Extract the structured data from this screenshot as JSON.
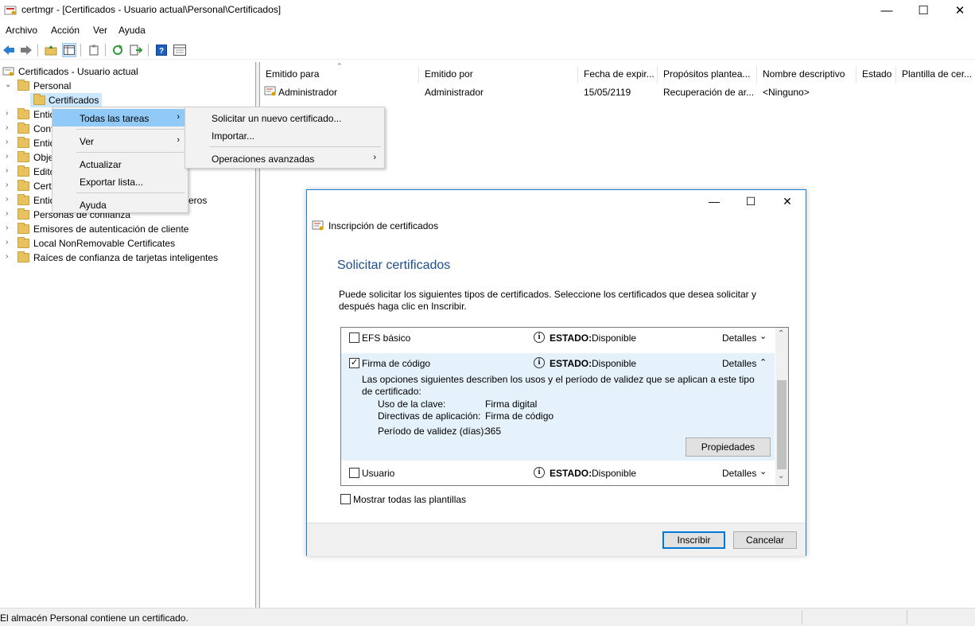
{
  "window": {
    "title": "certmgr - [Certificados - Usuario actual\\Personal\\Certificados]",
    "minimize": "—",
    "maximize": "☐",
    "close": "✕"
  },
  "menubar": [
    "Archivo",
    "Acción",
    "Ver",
    "Ayuda"
  ],
  "tree": {
    "root": "Certificados - Usuario actual",
    "personal": "Personal",
    "certificados": "Certificados",
    "items": [
      "Entid",
      "Conf",
      "Entid",
      "Obje",
      "Edito",
      "Cert",
      "Entid",
      "Personas de confianza",
      "Emisores de autenticación de cliente",
      "Local NonRemovable Certificates",
      "Raíces de confianza de tarjetas inteligentes"
    ],
    "partial_text": "eros"
  },
  "columns": [
    "Emitido para",
    "Emitido por",
    "Fecha de expir...",
    "Propósitos plantea...",
    "Nombre descriptivo",
    "Estado",
    "Plantilla de cer..."
  ],
  "rows": [
    [
      "Administrador",
      "Administrador",
      "15/05/2119",
      "Recuperación de ar...",
      "<Ninguno>",
      "",
      ""
    ]
  ],
  "context_menu": {
    "items": [
      "Todas las tareas",
      "Ver",
      "Actualizar",
      "Exportar lista...",
      "Ayuda"
    ]
  },
  "submenu": {
    "items": [
      "Solicitar un nuevo certificado...",
      "Importar...",
      "Operaciones avanzadas"
    ]
  },
  "dialog": {
    "title": "Inscripción de certificados",
    "heading": "Solicitar certificados",
    "description": "Puede solicitar los siguientes tipos de certificados. Seleccione los certificados que desea solicitar y después haga clic en Inscribir.",
    "estado_label": "ESTADO:",
    "details_label": "Detalles",
    "certs": [
      {
        "name": "EFS básico",
        "status": "Disponible",
        "checked": false
      },
      {
        "name": "Firma de código",
        "status": "Disponible",
        "checked": true
      },
      {
        "name": "Usuario",
        "status": "Disponible",
        "checked": false
      }
    ],
    "expanded_text": "Las opciones siguientes describen los usos y el período de validez que se aplican a este tipo de certificado:",
    "props": [
      {
        "k": "Uso de la clave:",
        "v": "Firma digital"
      },
      {
        "k": "Directivas de aplicación:",
        "v": "Firma de código"
      },
      {
        "k": "Período de validez (días):",
        "v": "365"
      }
    ],
    "properties_btn": "Propiedades",
    "show_all": "Mostrar todas las plantillas",
    "enroll_btn": "Inscribir",
    "cancel_btn": "Cancelar"
  },
  "statusbar": {
    "text": "El almacén Personal contiene un certificado."
  },
  "colors": {
    "accent": "#0078d7",
    "menu_highlight": "#91c9f7",
    "heading": "#1e4e8c",
    "expanded_bg": "#e5f1fb"
  }
}
